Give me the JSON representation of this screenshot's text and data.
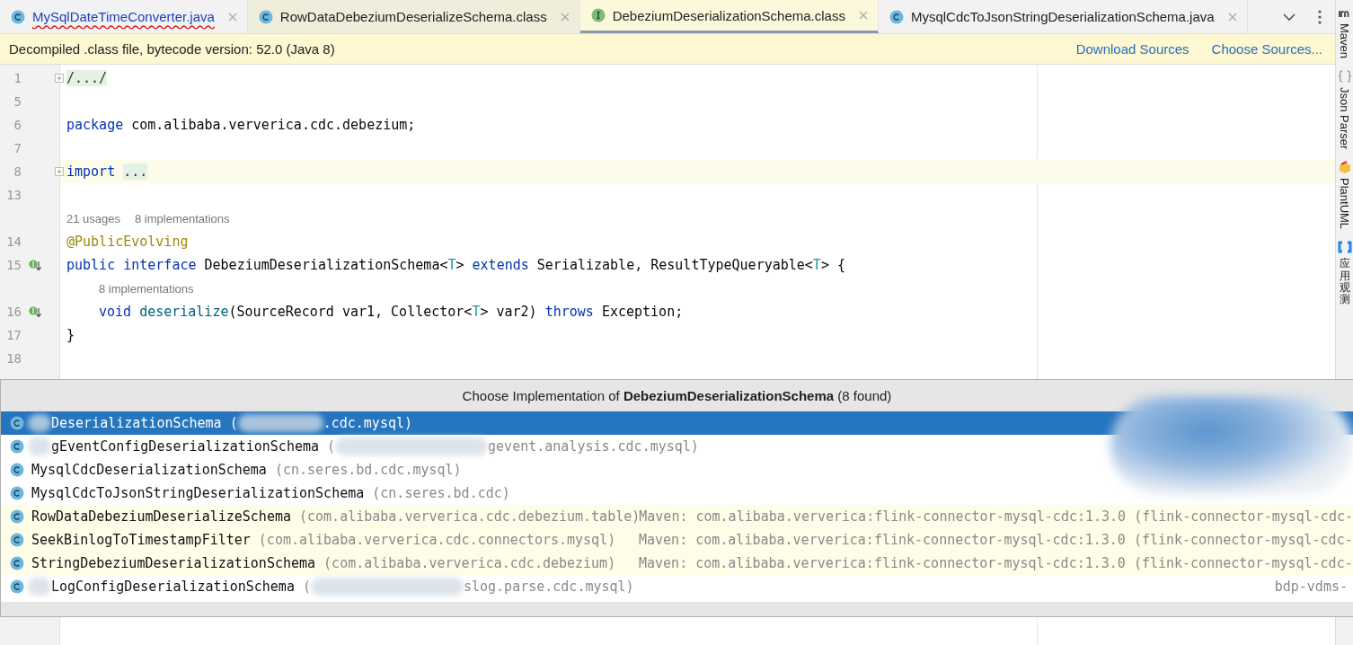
{
  "tabs": [
    {
      "label": "MySqlDateTimeConverter.java",
      "kind": "class",
      "library": false,
      "error": true,
      "selected": false
    },
    {
      "label": "RowDataDebeziumDeserializeSchema.class",
      "kind": "class",
      "library": true,
      "error": false,
      "selected": false
    },
    {
      "label": "DebeziumDeserializationSchema.class",
      "kind": "interface",
      "library": true,
      "error": false,
      "selected": true
    },
    {
      "label": "MysqlCdcToJsonStringDeserializationSchema.java",
      "kind": "class",
      "library": false,
      "error": false,
      "selected": false
    }
  ],
  "banner": {
    "text": "Decompiled .class file, bytecode version: 52.0 (Java 8)",
    "links": [
      "Download Sources",
      "Choose Sources..."
    ]
  },
  "editor": {
    "lines": [
      {
        "kind": "code",
        "number": "1",
        "fold": true,
        "current": false,
        "implemented": false,
        "tokens": [
          {
            "kind": "folded",
            "text": "/.../"
          }
        ]
      },
      {
        "kind": "code",
        "number": "5",
        "fold": false,
        "current": false,
        "implemented": false
      },
      {
        "kind": "code",
        "number": "6",
        "fold": false,
        "current": false,
        "implemented": false,
        "tokens": [
          {
            "kind": "keyword",
            "text": "package"
          },
          {
            "kind": "plain",
            "text": " com.alibaba.ververica.cdc.debezium;"
          }
        ]
      },
      {
        "kind": "code",
        "number": "7",
        "fold": false,
        "current": false,
        "implemented": false
      },
      {
        "kind": "code",
        "number": "8",
        "fold": true,
        "current": true,
        "implemented": false,
        "tokens": [
          {
            "kind": "keyword",
            "text": "import"
          },
          {
            "kind": "folded",
            "text": "..."
          }
        ]
      },
      {
        "kind": "code",
        "number": "13",
        "fold": false,
        "current": false,
        "implemented": false
      },
      {
        "kind": "hint",
        "texts": [
          "21 usages",
          "8 implementations"
        ]
      },
      {
        "kind": "code",
        "number": "14",
        "fold": false,
        "current": false,
        "implemented": false,
        "tokens": [
          {
            "kind": "annotation",
            "text": "@PublicEvolving"
          }
        ]
      },
      {
        "kind": "code",
        "number": "15",
        "fold": false,
        "current": false,
        "implemented": true,
        "tokens": [
          {
            "kind": "keyword",
            "text": "public interface"
          },
          {
            "kind": "plain",
            "text": " DebeziumDeserializationSchema<"
          },
          {
            "kind": "typeparam",
            "text": "T"
          },
          {
            "kind": "plain",
            "text": "> "
          },
          {
            "kind": "keyword",
            "text": "extends"
          },
          {
            "kind": "plain",
            "text": " Serializable, ResultTypeQueryable<"
          },
          {
            "kind": "typeparam",
            "text": "T"
          },
          {
            "kind": "plain",
            "text": "> {"
          }
        ],
        "children": [
          {
            "kind": "hint",
            "texts": [
              "8 implementations"
            ]
          },
          {
            "kind": "code",
            "number": "16",
            "fold": false,
            "current": false,
            "implemented": true,
            "tokens": [
              {
                "kind": "keyword",
                "text": "void"
              },
              {
                "kind": "method",
                "text": "deserialize"
              },
              {
                "kind": "plain",
                "text": "(SourceRecord var1, Collector<"
              },
              {
                "kind": "typeparam",
                "text": "T"
              },
              {
                "kind": "plain",
                "text": "> var2) "
              },
              {
                "kind": "keyword",
                "text": "throws"
              },
              {
                "kind": "plain",
                "text": " Exception;"
              }
            ]
          }
        ]
      },
      {
        "kind": "code",
        "number": "17",
        "fold": false,
        "current": false,
        "implemented": false,
        "tokens": [
          {
            "kind": "plain",
            "text": "}"
          }
        ]
      },
      {
        "kind": "code",
        "number": "18",
        "fold": false,
        "current": false,
        "implemented": false
      }
    ]
  },
  "popup": {
    "title_prefix": "Choose Implementation of ",
    "title_bold": "DebeziumDeserializationSchema",
    "title_suffix": " (8 found)",
    "items": [
      {
        "name": "DeserializationSchema",
        "name_blurred": true,
        "package_parts": [
          "(",
          ".cdc.mysql)"
        ],
        "kind": "project",
        "selected": true
      },
      {
        "name": "gEventConfigDeserializationSchema",
        "name_blurred": true,
        "package_parts": [
          "(",
          "gevent.analysis.cdc.mysql)"
        ],
        "kind": "project",
        "selected": false
      },
      {
        "name": "MysqlCdcDeserializationSchema",
        "name_blurred": false,
        "package_parts": [
          "(cn.seres.bd.cdc.mysql)"
        ],
        "kind": "project",
        "selected": false
      },
      {
        "name": "MysqlCdcToJsonStringDeserializationSchema",
        "name_blurred": false,
        "package_parts": [
          "(cn.seres.bd.cdc)"
        ],
        "kind": "project",
        "selected": false
      },
      {
        "name": "RowDataDebeziumDeserializeSchema",
        "name_blurred": false,
        "package_parts": [
          "(com.alibaba.ververica.cdc.debezium.table)"
        ],
        "location": "Maven: com.alibaba.ververica:flink-connector-mysql-cdc:1.3.0 (flink-connector-mysql-cdc-",
        "kind": "library",
        "selected": false
      },
      {
        "name": "SeekBinlogToTimestampFilter",
        "name_blurred": false,
        "package_parts": [
          "(com.alibaba.ververica.cdc.connectors.mysql)"
        ],
        "location": "Maven: com.alibaba.ververica:flink-connector-mysql-cdc:1.3.0 (flink-connector-mysql-cdc-",
        "kind": "library",
        "selected": false
      },
      {
        "name": "StringDebeziumDeserializationSchema",
        "name_blurred": false,
        "package_parts": [
          "(com.alibaba.ververica.cdc.debezium)"
        ],
        "location": "Maven: com.alibaba.ververica:flink-connector-mysql-cdc:1.3.0 (flink-connector-mysql-cdc-",
        "kind": "library",
        "selected": false
      },
      {
        "name": "LogConfigDeserializationSchema",
        "name_blurred": true,
        "package_parts": [
          "(",
          "slog.parse.cdc.mysql)"
        ],
        "location": "bdp-vdms-",
        "kind": "project",
        "selected": false
      }
    ]
  },
  "tool_strip": [
    {
      "label": "Maven",
      "kind": "maven"
    },
    {
      "label": "Json Parser",
      "kind": "json"
    },
    {
      "label": "PlantUML",
      "kind": "plantuml"
    },
    {
      "label": "应用观测",
      "kind": "observability"
    }
  ]
}
